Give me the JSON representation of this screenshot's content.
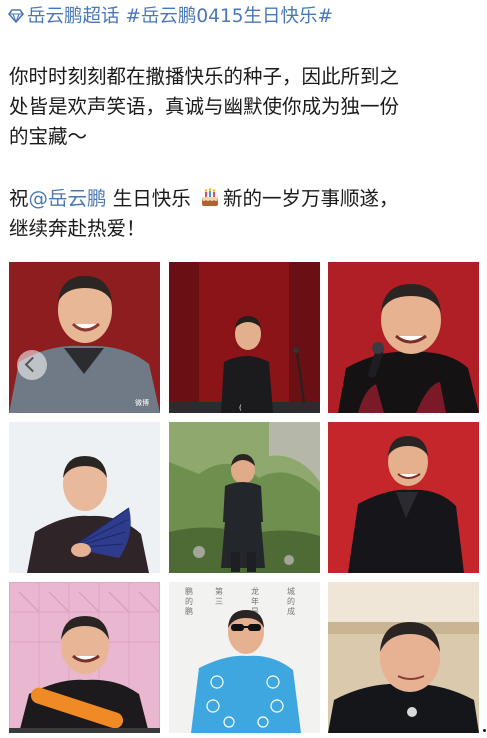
{
  "topic": {
    "icon": "diamond-topic-icon",
    "tag1": "岳云鹏超话",
    "tag2": "#岳云鹏0415生日快乐#"
  },
  "post": {
    "line1": "你时时刻刻都在撒播快乐的种子，因此所到之",
    "line2": "处皆是欢声笑语，真诚与幽默使你成为独一份",
    "line3": "的宝藏～",
    "wish_prefix": "祝",
    "mention": "@岳云鹏",
    "wish_middle": " 生日快乐 ",
    "cake_icon": "birthday-cake-icon",
    "wish_suffix": "新的一岁万事顺遂，",
    "line5": "继续奔赴热爱！"
  },
  "photos": [
    {
      "name": "photo-portrait-red-background",
      "bg": "#8e1d1f"
    },
    {
      "name": "photo-stage-dark-red-curtain",
      "bg": "#8a1418"
    },
    {
      "name": "photo-stage-microphone-red",
      "bg": "#b01f26"
    },
    {
      "name": "photo-holding-blue-fan",
      "bg": "#eef1f4"
    },
    {
      "name": "photo-green-mountain-outdoor",
      "bg": "#6f8f4e"
    },
    {
      "name": "photo-stage-red-backdrop",
      "bg": "#c4262b"
    },
    {
      "name": "photo-pink-wall-orange-prop",
      "bg": "#e9b7cf"
    },
    {
      "name": "photo-sunglasses-blue-jacket",
      "bg": "#f2f2f0"
    },
    {
      "name": "photo-beige-room-closeup",
      "bg": "#dbc9ad"
    }
  ],
  "photo_texts": {
    "watermark": "微博",
    "calligraphy": [
      "鹏",
      "第",
      "龙",
      "城",
      "的",
      "三",
      "年",
      "的",
      "鹏",
      "是",
      "成"
    ]
  }
}
